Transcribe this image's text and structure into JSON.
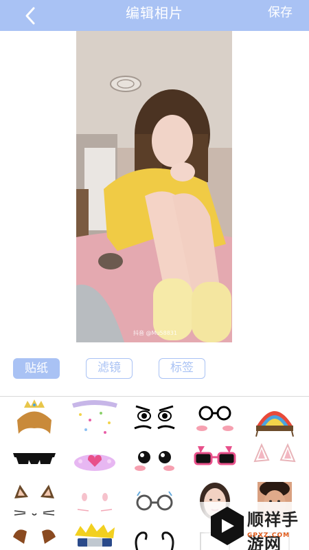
{
  "header": {
    "title": "编辑相片",
    "save_label": "保存",
    "bg_color": "#a9c2f4"
  },
  "photo": {
    "watermark": "抖音 @Mu58831"
  },
  "tabs": [
    {
      "label": "贴纸",
      "active": true
    },
    {
      "label": "滤镜",
      "active": false
    },
    {
      "label": "标签",
      "active": false
    }
  ],
  "stickers": [
    "crown-wig",
    "fairy-lights",
    "angry-eyes",
    "glasses-blush",
    "feather-headdress",
    "sunglasses",
    "pink-heart-crown",
    "cute-eyes-blush",
    "bunny-glasses",
    "fox-ears",
    "cat-ears",
    "cat-whiskers",
    "round-glasses",
    "face-woman",
    "face-man",
    "puppy-ears",
    "naruto-headband",
    "curly-antlers",
    "frame",
    "frame"
  ],
  "brand": {
    "name": "顺祥手游网",
    "url": "GPXZ.COM"
  }
}
